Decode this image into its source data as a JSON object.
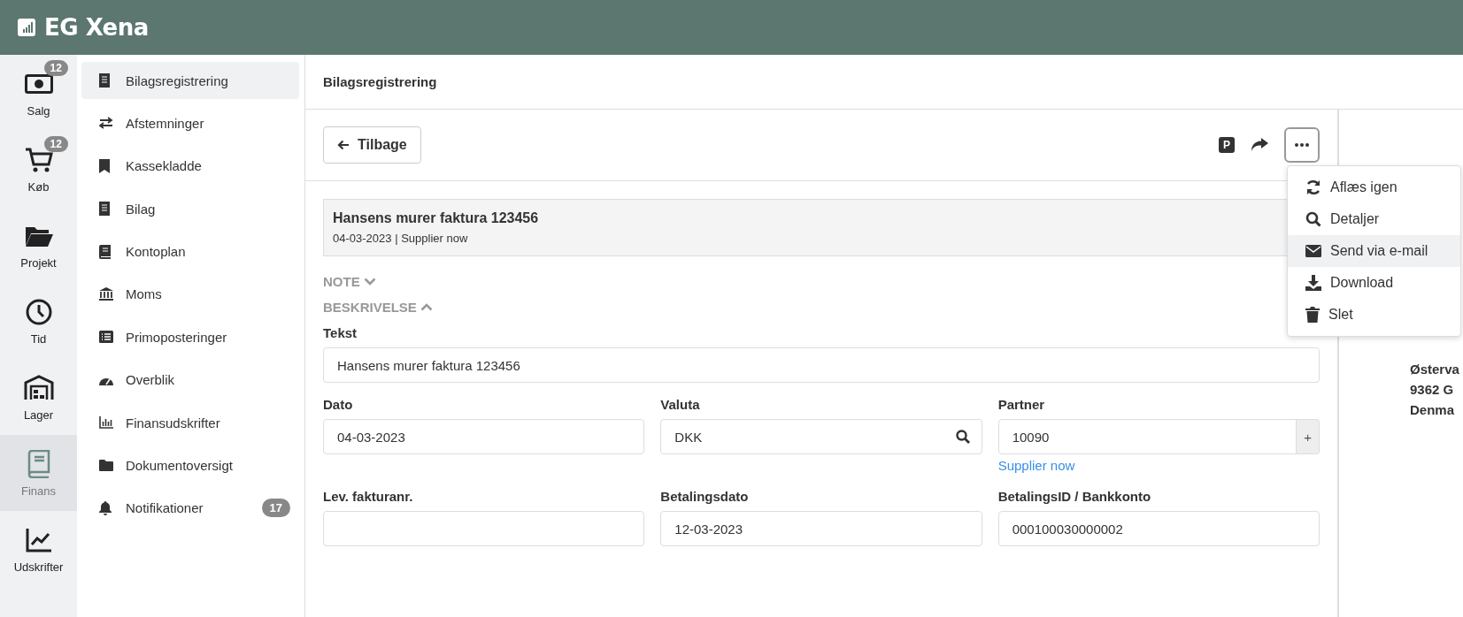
{
  "app": {
    "title": "EG Xena"
  },
  "rail": [
    {
      "kind": "cash",
      "label": "Salg",
      "badge": "12",
      "selected": false
    },
    {
      "kind": "cart",
      "label": "Køb",
      "badge": "12",
      "selected": false
    },
    {
      "kind": "folder",
      "label": "Projekt",
      "selected": false
    },
    {
      "kind": "clock",
      "label": "Tid",
      "selected": false
    },
    {
      "kind": "warehouse",
      "label": "Lager",
      "selected": false
    },
    {
      "kind": "book",
      "label": "Finans",
      "selected": true
    },
    {
      "kind": "chart",
      "label": "Udskrifter",
      "selected": false
    }
  ],
  "submenu": [
    {
      "kind": "receipt",
      "label": "Bilagsregistrering",
      "selected": true
    },
    {
      "kind": "exchange",
      "label": "Afstemninger",
      "selected": false
    },
    {
      "kind": "bookmark",
      "label": "Kassekladde",
      "selected": false
    },
    {
      "kind": "receipt",
      "label": "Bilag",
      "selected": false
    },
    {
      "kind": "book",
      "label": "Kontoplan",
      "selected": false
    },
    {
      "kind": "bank",
      "label": "Moms",
      "selected": false
    },
    {
      "kind": "list",
      "label": "Primoposteringer",
      "selected": false
    },
    {
      "kind": "gauge",
      "label": "Overblik",
      "selected": false
    },
    {
      "kind": "bars",
      "label": "Finansudskrifter",
      "selected": false
    },
    {
      "kind": "folder",
      "label": "Dokumentoversigt",
      "selected": false
    },
    {
      "kind": "bell",
      "label": "Notifikationer",
      "selected": false,
      "badge": "17"
    }
  ],
  "page": {
    "title": "Bilagsregistrering"
  },
  "toolbar": {
    "back": "Tilbage",
    "p_label": "P"
  },
  "menu": [
    {
      "kind": "refresh",
      "label": "Aflæs igen",
      "selected": false
    },
    {
      "kind": "search",
      "label": "Detaljer",
      "selected": false
    },
    {
      "kind": "mail",
      "label": "Send via e-mail",
      "selected": true
    },
    {
      "kind": "download",
      "label": "Download",
      "selected": false
    },
    {
      "kind": "trash",
      "label": "Slet",
      "selected": false
    }
  ],
  "document": {
    "title": "Hansens murer faktura 123456",
    "date": "04-03-2023",
    "separator": "|",
    "partner": "Supplier now"
  },
  "sections": [
    {
      "label": "NOTE",
      "expanded": false
    },
    {
      "label": "BESKRIVELSE",
      "expanded": true
    }
  ],
  "text_field": {
    "label": "Tekst",
    "value": "Hansens murer faktura 123456"
  },
  "fields": [
    {
      "kind": "text",
      "label": "Dato",
      "value": "04-03-2023"
    },
    {
      "kind": "search",
      "label": "Valuta",
      "value": "DKK"
    },
    {
      "kind": "addon",
      "label": "Partner",
      "value": "10090",
      "addon": "+",
      "link": "Supplier now"
    },
    {
      "kind": "text",
      "label": "Lev. fakturanr."
    },
    {
      "kind": "text",
      "label": "Betalingsdato",
      "value": "12-03-2023"
    },
    {
      "kind": "text",
      "label": "BetalingsID / Bankkonto",
      "value": "000100030000002"
    }
  ],
  "address": [
    "Østerva",
    "9362 G",
    "Denma"
  ]
}
